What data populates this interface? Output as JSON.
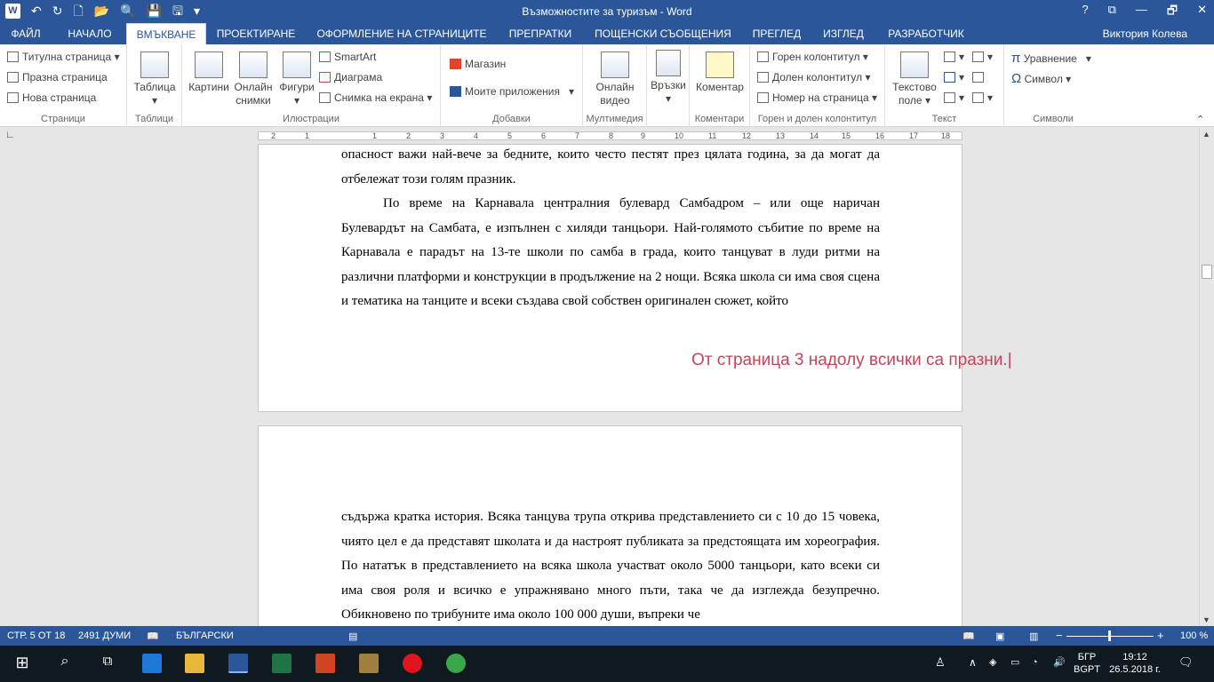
{
  "window": {
    "title": "Възможностите за туризъм - Word",
    "help": "?",
    "restore": "🗗",
    "minimize": "—",
    "close": "✕"
  },
  "tabs": [
    {
      "label": "ФАЙЛ"
    },
    {
      "label": "НАЧАЛО"
    },
    {
      "label": "ВМЪКВАНЕ"
    },
    {
      "label": "ПРОЕКТИРАНЕ"
    },
    {
      "label": "ОФОРМЛЕНИЕ НА СТРАНИЦИТЕ"
    },
    {
      "label": "ПРЕПРАТКИ"
    },
    {
      "label": "ПОЩЕНСКИ СЪОБЩЕНИЯ"
    },
    {
      "label": "ПРЕГЛЕД"
    },
    {
      "label": "ИЗГЛЕД"
    },
    {
      "label": "РАЗРАБОТЧИК"
    }
  ],
  "user": "Виктория Колева",
  "ribbon": {
    "pages": {
      "cover": "Титулна страница",
      "blank": "Празна страница",
      "break": "Нова страница",
      "label": "Страници"
    },
    "tables": {
      "table": "Таблица",
      "label": "Таблици"
    },
    "illus": {
      "pictures": "Картини",
      "online1": "Онлайн",
      "online2": "снимки",
      "shapes": "Фигури",
      "smartart": "SmartArt",
      "chart": "Диаграма",
      "screenshot": "Снимка на екрана",
      "label": "Илюстрации"
    },
    "addins": {
      "store": "Магазин",
      "myapps": "Моите приложения",
      "label": "Добавки"
    },
    "media": {
      "v1": "Онлайн",
      "v2": "видео",
      "label": "Мултимедия"
    },
    "links": {
      "label": "Връзки"
    },
    "comments": {
      "comment": "Коментар",
      "label": "Коментари"
    },
    "hf": {
      "header": "Горен колонтитул",
      "footer": "Долен колонтитул",
      "pagenum": "Номер на страница",
      "label": "Горен и долен колонтитул"
    },
    "text": {
      "tb1": "Текстово",
      "tb2": "поле",
      "label": "Текст"
    },
    "symbols": {
      "eq": "Уравнение",
      "sym": "Символ",
      "label": "Символи"
    }
  },
  "ruler": [
    "2",
    "1",
    "1",
    "2",
    "3",
    "4",
    "5",
    "6",
    "7",
    "8",
    "9",
    "10",
    "11",
    "12",
    "13",
    "14",
    "15",
    "16",
    "17",
    "18"
  ],
  "doc": {
    "p1": "опасност важи най-вече за бедните, които често пестят през цялата година, за да могат да отбележат този голям празник.",
    "p2": "По време на Карнавала централния булевард Самбадром – или още наричан Булевардът на Самбата, е изпълнен с хиляди танцьори. Най-голямото събитие по време на Карнавала е парадът на 13-те школи по самба в града, които танцуват в луди ритми на различни платформи и конструкции в продължение на 2 нощи. Всяка школа си има своя сцена и тематика на танците и всеки създава свой собствен оригинален сюжет, който",
    "p3": "съдържа кратка история. Всяка танцува трупа открива представлението си с 10 до 15 човека, чиято цел е да представят школата и да настроят публиката за предстоящата им хореография. По нататък в представлението на всяка школа участват около 5000 танцьори, като всеки си има своя роля и всичко е упражнявано много пъти, така че да изглежда безупречно. Обикновено по трибуните има около 100 000 души, въпреки че",
    "note": "От страница 3 надолу всички са празни.|"
  },
  "status": {
    "page": "СТР. 5 ОТ 18",
    "words": "2491 ДУМИ",
    "lang": "БЪЛГАРСКИ",
    "zoom": "100 %",
    "minus": "−",
    "plus": "+"
  },
  "taskbar": {
    "lang1": "БГР",
    "lang2": "BGPT",
    "time": "19:12",
    "date": "26.5.2018 г."
  },
  "colors": {
    "accent": "#2b579a",
    "note": "#c8435a"
  }
}
